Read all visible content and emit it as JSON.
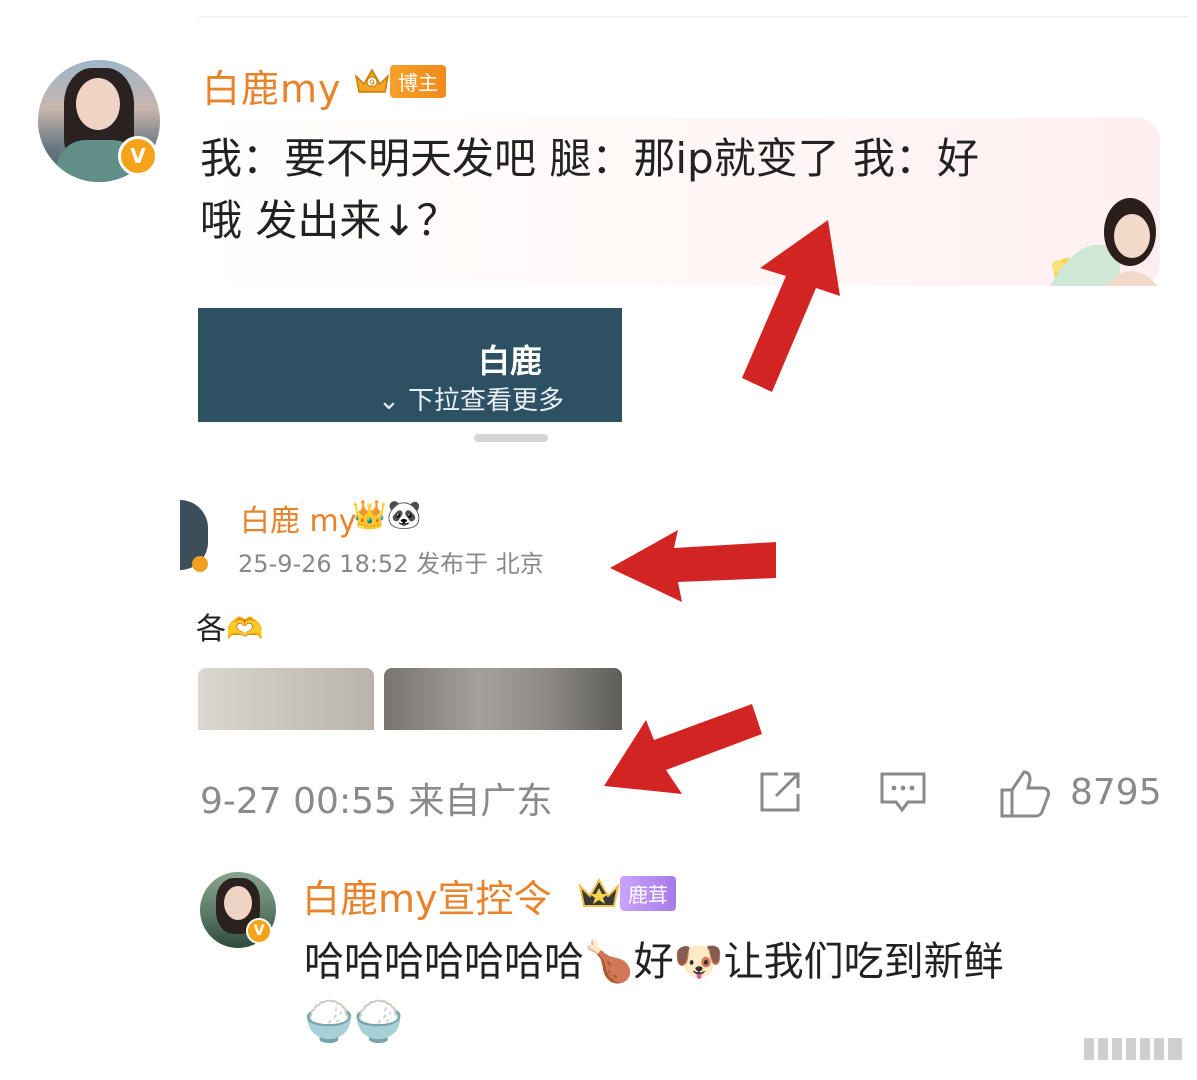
{
  "post": {
    "author": "白鹿my",
    "author_tag": "博主",
    "text_line1": "我：要不明天发吧 腿：那ip就变了 我：好",
    "text_line2": "哦 发出来↓？",
    "timestamp": "9-27 00:55 来自广东",
    "like_count": "8795"
  },
  "embedded_screenshot": {
    "card_title": "白鹿",
    "card_subtitle": "⌄ 下拉查看更多",
    "inner_author": "白鹿 my",
    "inner_icons": "👑🐼",
    "inner_meta": "25-9-26 18:52  发布于 北京",
    "inner_text": "各🫶"
  },
  "reply": {
    "author": "白鹿my宣控令",
    "author_tag": "鹿茸",
    "text_line1": "哈哈哈哈哈哈哈🍗好🐶让我们吃到新鲜",
    "text_line2": "🍚🍚"
  },
  "icons": {
    "share": "share-icon",
    "comment": "comment-icon",
    "like": "thumbs-up-icon",
    "verified": "verified-v-icon",
    "arrow": "red-arrow-annotation"
  },
  "colors": {
    "username": "#e8832b",
    "annotation_red": "#d32424",
    "card_bg": "#2d5163"
  }
}
